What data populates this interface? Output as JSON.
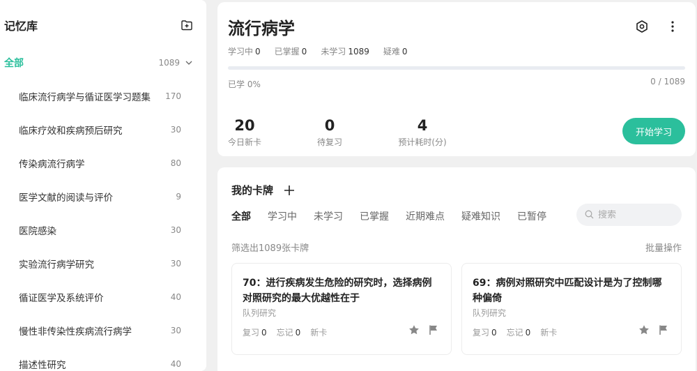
{
  "sidebar": {
    "title": "记忆库",
    "all_label": "全部",
    "all_count": "1089",
    "items": [
      {
        "label": "临床流行病学与循证医学习题集",
        "count": "170"
      },
      {
        "label": "临床疗效和疾病预后研究",
        "count": "30"
      },
      {
        "label": "传染病流行病学",
        "count": "80"
      },
      {
        "label": "医学文献的阅读与评价",
        "count": "9"
      },
      {
        "label": "医院感染",
        "count": "30"
      },
      {
        "label": "实验流行病学研究",
        "count": "30"
      },
      {
        "label": "循证医学及系统评价",
        "count": "40"
      },
      {
        "label": "慢性非传染性疾病流行病学",
        "count": "30"
      },
      {
        "label": "描述性研究",
        "count": "40"
      }
    ]
  },
  "deck": {
    "title": "流行病学",
    "stats": [
      {
        "label": "学习中",
        "value": "0"
      },
      {
        "label": "已掌握",
        "value": "0"
      },
      {
        "label": "未学习",
        "value": "1089"
      },
      {
        "label": "疑难",
        "value": "0"
      }
    ],
    "progress_fraction": 0,
    "learned_text": "已学 0%",
    "progress_text": "0 / 1089",
    "metrics": [
      {
        "value": "20",
        "label": "今日新卡"
      },
      {
        "value": "0",
        "label": "待复习"
      },
      {
        "value": "4",
        "label": "预计耗时(分)"
      }
    ],
    "start_label": "开始学习"
  },
  "cards_section": {
    "title": "我的卡牌",
    "tabs": [
      "全部",
      "学习中",
      "未学习",
      "已掌握",
      "近期难点",
      "疑难知识",
      "已暂停"
    ],
    "search_placeholder": "搜索",
    "filter_text": "筛选出1089张卡牌",
    "batch_label": "批量操作",
    "cards": [
      {
        "question": "70：进行疾病发生危险的研究时，选择病例对照研究的最大优越性在于",
        "tag": "队列研究",
        "review_label": "复习",
        "review": "0",
        "forget_label": "忘记",
        "forget": "0",
        "status": "新卡"
      },
      {
        "question": "69：病例对照研究中匹配设计是为了控制哪种偏倚",
        "tag": "队列研究",
        "review_label": "复习",
        "review": "0",
        "forget_label": "忘记",
        "forget": "0",
        "status": "新卡"
      }
    ]
  },
  "colors": {
    "accent": "#2bbf9c",
    "background": "#f0f0f0"
  }
}
